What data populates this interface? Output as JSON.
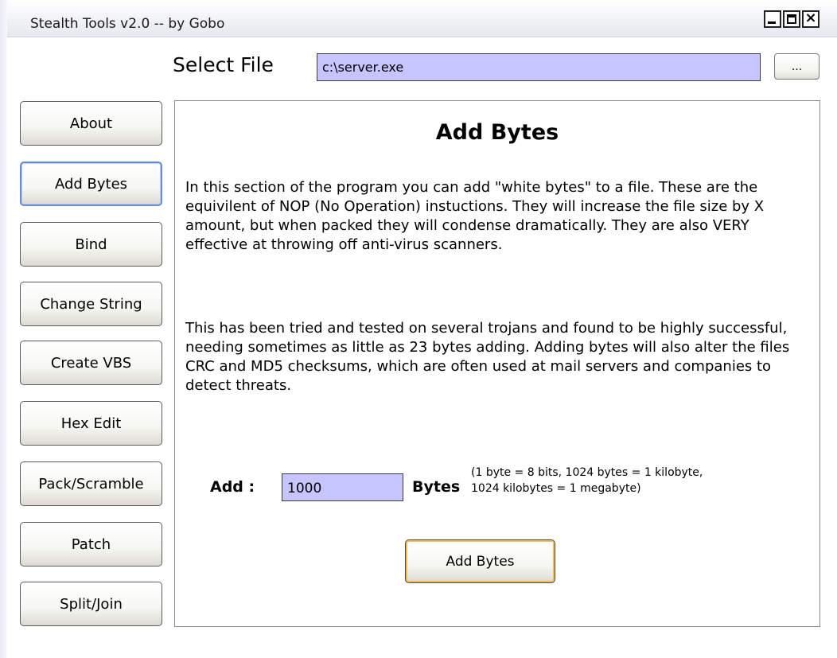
{
  "window": {
    "title": "Stealth Tools v2.0 -- by Gobo"
  },
  "file_select": {
    "label": "Select File",
    "path_value": "c:\\server.exe",
    "browse_label": "..."
  },
  "sidebar": {
    "items": [
      {
        "label": "About",
        "active": false
      },
      {
        "label": "Add Bytes",
        "active": true
      },
      {
        "label": "Bind",
        "active": false
      },
      {
        "label": "Change String",
        "active": false
      },
      {
        "label": "Create VBS",
        "active": false
      },
      {
        "label": "Hex Edit",
        "active": false
      },
      {
        "label": "Pack/Scramble",
        "active": false
      },
      {
        "label": "Patch",
        "active": false
      },
      {
        "label": "Split/Join",
        "active": false
      }
    ]
  },
  "panel": {
    "title": "Add Bytes",
    "paragraph1": "In this section of the program you can add \"white bytes\" to a file. These are the equivilent of NOP (No Operation) instuctions. They will increase the file size by X amount, but when packed they will condense dramatically. They are also VERY effective at throwing off anti-virus scanners.",
    "paragraph2": "This has been tried and tested on several trojans and found to be highly successful, needing sometimes as little as 23 bytes adding. Adding bytes will also alter the files CRC and MD5 checksums, which are often used at mail servers and companies to detect threats.",
    "add_label": "Add :",
    "bytes_value": "1000",
    "bytes_label": "Bytes",
    "note_line1": "(1 byte = 8 bits, 1024 bytes = 1 kilobyte,",
    "note_line2": "1024 kilobytes = 1 megabyte)",
    "action_button": "Add Bytes"
  },
  "colors": {
    "input_bg": "#c7c5ff",
    "active_border": "#6a8dd9",
    "default_button_focus": "#f0bd55"
  }
}
